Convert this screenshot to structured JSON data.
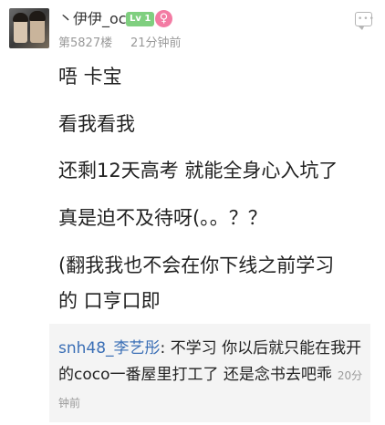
{
  "post": {
    "username": "丶伊伊_oc",
    "level_badge": "Lv 1",
    "gender_icon": "♀",
    "floor": "第5827楼",
    "time": "21分钟前",
    "content_lines": [
      "唔 卡宝",
      "看我看我",
      "还剩12天高考 就能全身心入坑了",
      "真是迫不及待呀(。。？？",
      "(翻我我也不会在你下线之前学习",
      "的 口亨口即"
    ]
  },
  "reply": {
    "username": "snh48_李艺彤",
    "separator": ": ",
    "text": "不学习 你以后就只能在我开的coco一番屋里打工了 还是念书去吧乖",
    "time": "20分钟前"
  },
  "colors": {
    "link_blue": "#3b6fb6",
    "level_green": "#7fcf7f",
    "gender_pink": "#f37ba3",
    "meta_gray": "#9a9a9a"
  }
}
